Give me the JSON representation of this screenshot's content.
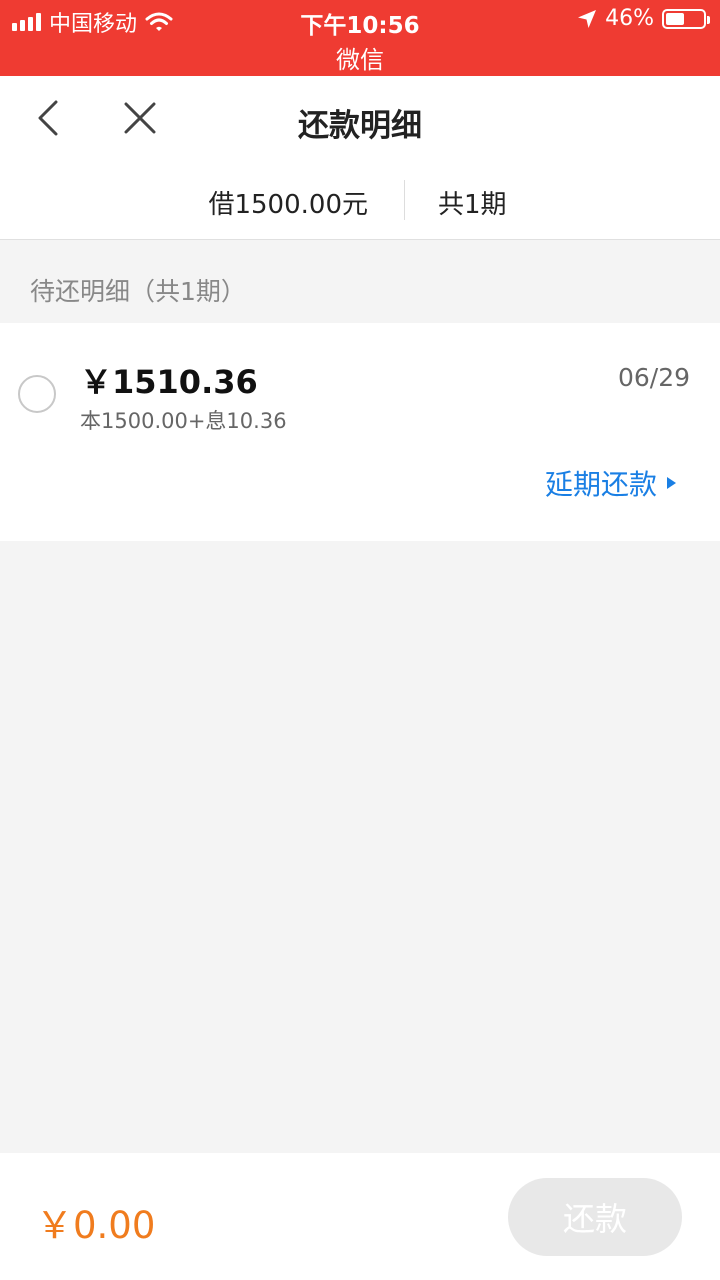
{
  "status_bar": {
    "carrier": "中国移动",
    "time": "下午10:56",
    "battery": "46%",
    "app_name": "微信",
    "icons": [
      "signal-icon",
      "wifi-icon",
      "location-arrow-icon",
      "battery-icon"
    ]
  },
  "nav": {
    "title": "还款明细",
    "icons": [
      "back-icon",
      "close-icon"
    ]
  },
  "summary": {
    "loan": "借1500.00元",
    "periods": "共1期"
  },
  "section": {
    "header": "待还明细（共1期）"
  },
  "items": [
    {
      "amount": "￥1510.36",
      "breakdown": "本1500.00+息10.36",
      "date": "06/29",
      "extend_label": "延期还款"
    }
  ],
  "footer": {
    "total": "￥0.00",
    "pay_label": "还款"
  },
  "colors": {
    "status_bar": "#ef3b32",
    "link": "#1a7fe4",
    "total": "#f07c1e",
    "button_disabled": "#e8e8e8"
  }
}
